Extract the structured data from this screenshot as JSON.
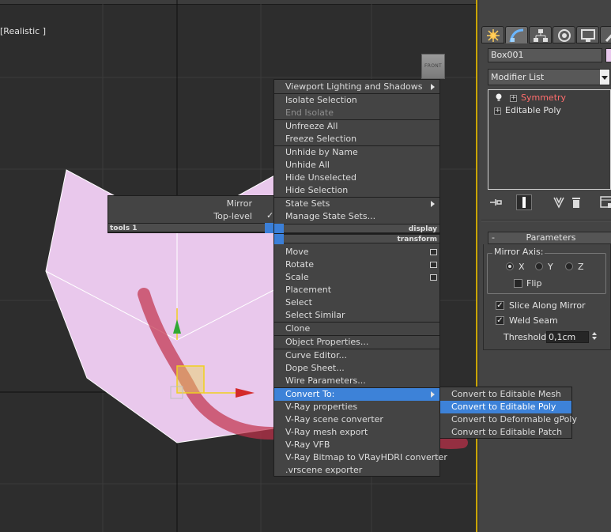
{
  "viewport": {
    "label": "[Realistic ]",
    "viewcube_label": "FRONT",
    "object_color": "#e9c8ec",
    "annotation_color": "#c0304a"
  },
  "quad_menu": {
    "left": {
      "items": [
        "Mirror",
        "Top-level"
      ],
      "header": "tools 1"
    },
    "display": {
      "header": "display",
      "items": [
        "Viewport Lighting and Shadows",
        "Isolate Selection",
        "End Isolate",
        "Unfreeze All",
        "Freeze Selection",
        "Unhide by Name",
        "Unhide All",
        "Hide Unselected",
        "Hide Selection",
        "State Sets",
        "Manage State Sets..."
      ]
    },
    "transform": {
      "header": "transform",
      "items": [
        "Move",
        "Rotate",
        "Scale",
        "Placement",
        "Select",
        "Select Similar",
        "Clone",
        "Object Properties...",
        "Curve Editor...",
        "Dope Sheet...",
        "Wire Parameters...",
        "Convert To:",
        "V-Ray properties",
        "V-Ray scene converter",
        "V-Ray mesh export",
        "V-Ray VFB",
        "V-Ray Bitmap to VRayHDRI converter",
        ".vrscene exporter"
      ]
    },
    "submenu": {
      "items": [
        "Convert to Editable Mesh",
        "Convert to Editable Poly",
        "Convert to Deformable gPoly",
        "Convert to Editable Patch"
      ],
      "highlighted": "Convert to Editable Poly"
    }
  },
  "command_panel": {
    "tabs": [
      "create-icon",
      "modify-icon",
      "hierarchy-icon",
      "motion-icon",
      "display-icon",
      "utilities-icon"
    ],
    "object_name": "Box001",
    "modifier_list_label": "Modifier List",
    "stack": [
      "Symmetry",
      "Editable Poly"
    ],
    "parameters": {
      "title": "Parameters",
      "collapse": "-",
      "mirror_axis_label": "Mirror Axis:",
      "axes": [
        "X",
        "Y",
        "Z"
      ],
      "selected_axis": "X",
      "flip_label": "Flip",
      "flip_checked": false,
      "slice_label": "Slice Along Mirror",
      "slice_checked": true,
      "weld_label": "Weld Seam",
      "weld_checked": true,
      "threshold_label": "Threshold:",
      "threshold_value": "0,1cm"
    }
  }
}
